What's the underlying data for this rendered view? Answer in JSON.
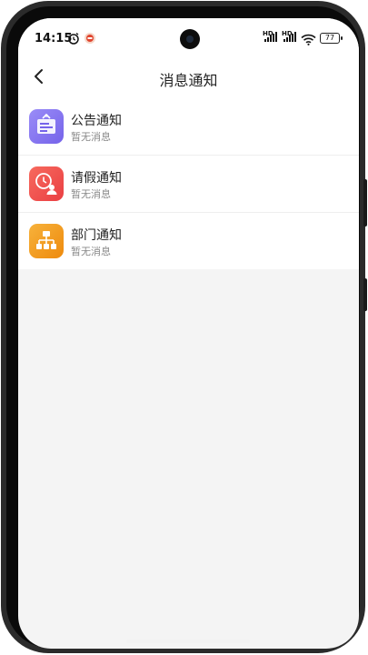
{
  "status_bar": {
    "time": "14:15",
    "network_label_1": "HD",
    "network_label_2": "HD",
    "battery": "77"
  },
  "nav": {
    "title": "消息通知",
    "back_icon": "chevron-left-icon"
  },
  "notifications": [
    {
      "title": "公告通知",
      "subtitle": "暂无消息",
      "icon": "announcement-board-icon",
      "color": "#8c7cf2"
    },
    {
      "title": "请假通知",
      "subtitle": "暂无消息",
      "icon": "clock-person-icon",
      "color": "#f2574f"
    },
    {
      "title": "部门通知",
      "subtitle": "暂无消息",
      "icon": "org-chart-icon",
      "color": "#f29c1b"
    }
  ],
  "colors": {
    "background": "#f4f4f4",
    "card": "#ffffff"
  }
}
